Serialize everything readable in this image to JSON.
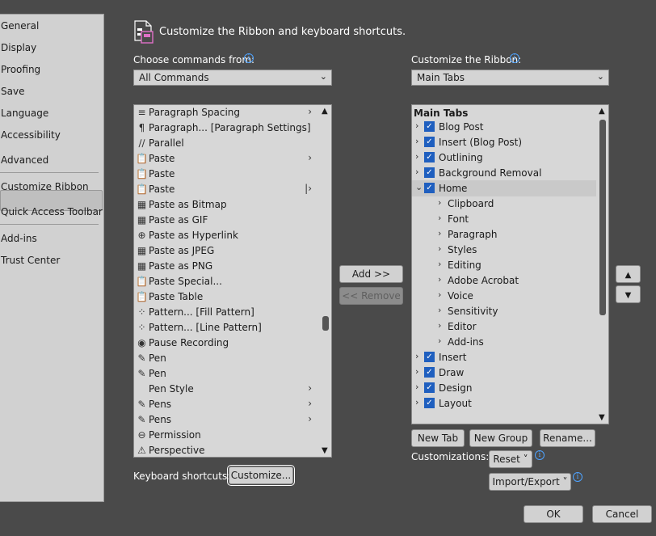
{
  "nav": {
    "items": [
      {
        "label": "General"
      },
      {
        "label": "Display"
      },
      {
        "label": "Proofing"
      },
      {
        "label": "Save"
      },
      {
        "label": "Language"
      },
      {
        "label": "Accessibility"
      },
      {
        "label": "Advanced"
      },
      {
        "label": "Customize Ribbon",
        "selected": true
      },
      {
        "label": "Quick Access Toolbar"
      },
      {
        "label": "Add-ins"
      },
      {
        "label": "Trust Center"
      }
    ]
  },
  "header": {
    "title": "Customize the Ribbon and keyboard shortcuts."
  },
  "left": {
    "choose_label": "Choose commands from:",
    "choose_value": "All Commands",
    "commands": [
      {
        "label": "Paragraph Spacing",
        "icon": "paragraph-spacing-icon",
        "glyph": "≡",
        "arrow": "›"
      },
      {
        "label": "Paragraph... [Paragraph Settings]",
        "icon": "paragraph-settings-icon",
        "glyph": "¶",
        "arrow": ""
      },
      {
        "label": "Parallel",
        "icon": "parallel-icon",
        "glyph": "∕∕",
        "arrow": ""
      },
      {
        "label": "Paste",
        "icon": "paste-icon",
        "glyph": "📋",
        "arrow": "›"
      },
      {
        "label": "Paste",
        "icon": "paste-icon",
        "glyph": "📋",
        "arrow": ""
      },
      {
        "label": "Paste",
        "icon": "paste-icon",
        "glyph": "📋",
        "arrow": "|›"
      },
      {
        "label": "Paste as Bitmap",
        "icon": "paste-bitmap-icon",
        "glyph": "▦",
        "arrow": ""
      },
      {
        "label": "Paste as GIF",
        "icon": "paste-gif-icon",
        "glyph": "▦",
        "arrow": ""
      },
      {
        "label": "Paste as Hyperlink",
        "icon": "paste-hyperlink-icon",
        "glyph": "⊕",
        "arrow": ""
      },
      {
        "label": "Paste as JPEG",
        "icon": "paste-jpeg-icon",
        "glyph": "▦",
        "arrow": ""
      },
      {
        "label": "Paste as PNG",
        "icon": "paste-png-icon",
        "glyph": "▦",
        "arrow": ""
      },
      {
        "label": "Paste Special...",
        "icon": "paste-special-icon",
        "glyph": "📋",
        "arrow": ""
      },
      {
        "label": "Paste Table",
        "icon": "paste-table-icon",
        "glyph": "📋",
        "arrow": ""
      },
      {
        "label": "Pattern... [Fill Pattern]",
        "icon": "fill-pattern-icon",
        "glyph": "⁘",
        "arrow": ""
      },
      {
        "label": "Pattern... [Line Pattern]",
        "icon": "line-pattern-icon",
        "glyph": "⁘",
        "arrow": ""
      },
      {
        "label": "Pause Recording",
        "icon": "pause-recording-icon",
        "glyph": "◉",
        "arrow": ""
      },
      {
        "label": "Pen",
        "icon": "pen-icon",
        "glyph": "✎",
        "arrow": ""
      },
      {
        "label": "Pen",
        "icon": "pen-icon",
        "glyph": "✎",
        "arrow": ""
      },
      {
        "label": "Pen Style",
        "icon": "",
        "glyph": "",
        "arrow": "›"
      },
      {
        "label": "Pens",
        "icon": "pens-icon",
        "glyph": "✎",
        "arrow": "›"
      },
      {
        "label": "Pens",
        "icon": "pens-icon",
        "glyph": "✎",
        "arrow": "›"
      },
      {
        "label": "Permission",
        "icon": "permission-icon",
        "glyph": "⊖",
        "arrow": ""
      },
      {
        "label": "Perspective",
        "icon": "perspective-icon",
        "glyph": "⚠",
        "arrow": ""
      }
    ],
    "keyboard_label": "Keyboard shortcuts:",
    "customize_button": "Customize..."
  },
  "middle": {
    "add_button": "Add >>",
    "remove_button": "<< Remove"
  },
  "right": {
    "customize_label": "Customize the Ribbon:",
    "customize_value": "Main Tabs",
    "tree_header": "Main Tabs",
    "tree": [
      {
        "label": "Blog Post",
        "level": 0,
        "checked": true,
        "expander": "›"
      },
      {
        "label": "Insert (Blog Post)",
        "level": 0,
        "checked": true,
        "expander": "›"
      },
      {
        "label": "Outlining",
        "level": 0,
        "checked": true,
        "expander": "›"
      },
      {
        "label": "Background Removal",
        "level": 0,
        "checked": true,
        "expander": "›"
      },
      {
        "label": "Home",
        "level": 0,
        "checked": true,
        "expander": "⌄",
        "highlight": true
      },
      {
        "label": "Clipboard",
        "level": 1,
        "expander": "›"
      },
      {
        "label": "Font",
        "level": 1,
        "expander": "›"
      },
      {
        "label": "Paragraph",
        "level": 1,
        "expander": "›"
      },
      {
        "label": "Styles",
        "level": 1,
        "expander": "›"
      },
      {
        "label": "Editing",
        "level": 1,
        "expander": "›"
      },
      {
        "label": "Adobe Acrobat",
        "level": 1,
        "expander": "›"
      },
      {
        "label": "Voice",
        "level": 1,
        "expander": "›"
      },
      {
        "label": "Sensitivity",
        "level": 1,
        "expander": "›"
      },
      {
        "label": "Editor",
        "level": 1,
        "expander": "›"
      },
      {
        "label": "Add-ins",
        "level": 1,
        "expander": "›"
      },
      {
        "label": "Insert",
        "level": 0,
        "checked": true,
        "expander": "›"
      },
      {
        "label": "Draw",
        "level": 0,
        "checked": true,
        "expander": "›"
      },
      {
        "label": "Design",
        "level": 0,
        "checked": true,
        "expander": "›"
      },
      {
        "label": "Layout",
        "level": 0,
        "checked": true,
        "expander": "›"
      }
    ],
    "new_tab_button": "New Tab",
    "new_group_button": "New Group",
    "rename_button": "Rename...",
    "customizations_label": "Customizations:",
    "reset_button": "Reset ˅",
    "import_export_button": "Import/Export ˅"
  },
  "footer": {
    "ok_button": "OK",
    "cancel_button": "Cancel"
  },
  "colors": {
    "background": "#4a4a4a",
    "checkbox": "#1f5fbf",
    "info": "#4ea3ff"
  }
}
